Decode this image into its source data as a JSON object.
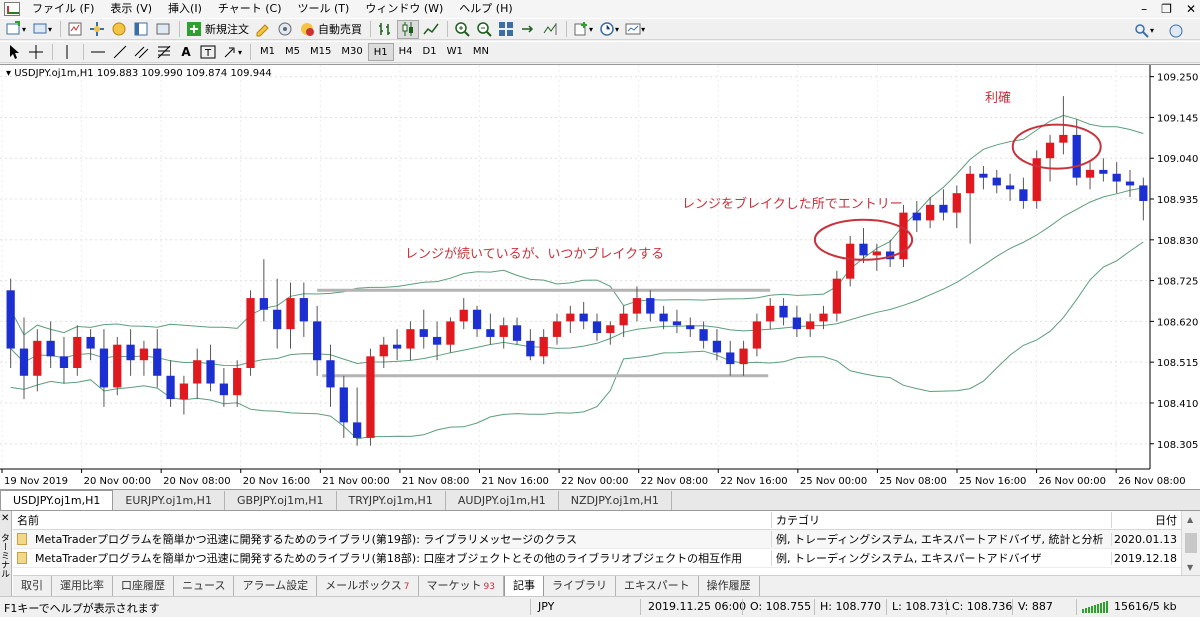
{
  "menu": [
    "ファイル (F)",
    "表示 (V)",
    "挿入(I)",
    "チャート (C)",
    "ツール (T)",
    "ウィンドウ (W)",
    "ヘルプ (H)"
  ],
  "toolbar": {
    "new_order_label": "新規注文",
    "auto_trade_label": "自動売買"
  },
  "timeframes": [
    "M1",
    "M5",
    "M15",
    "M30",
    "H1",
    "H4",
    "D1",
    "W1",
    "MN"
  ],
  "active_timeframe": "H1",
  "chart": {
    "header": "USDJPY.oj1m,H1  109.883 109.990 109.874 109.944",
    "colors": {
      "bull": "#e0191f",
      "bear": "#1c2fd0",
      "band": "#5c9e7c",
      "annotation": "#c8323c",
      "range_line": "#b4b4b4"
    },
    "annotations": {
      "range": "レンジが続いているが、いつかブレイクする",
      "breakout": "レンジをブレイクした所でエントリー",
      "take_profit": "利確"
    }
  },
  "chart_data": {
    "type": "candlestick",
    "symbol": "USDJPY.oj1m",
    "timeframe": "H1",
    "ylim": [
      108.24,
      109.28
    ],
    "y_ticks": [
      "109.250",
      "109.145",
      "109.040",
      "108.935",
      "108.830",
      "108.725",
      "108.620",
      "108.515",
      "108.410",
      "108.305"
    ],
    "x_ticks": [
      "19 Nov 2019",
      "20 Nov 00:00",
      "20 Nov 08:00",
      "20 Nov 16:00",
      "21 Nov 00:00",
      "21 Nov 08:00",
      "21 Nov 16:00",
      "22 Nov 00:00",
      "22 Nov 08:00",
      "22 Nov 16:00",
      "25 Nov 00:00",
      "25 Nov 08:00",
      "25 Nov 16:00",
      "26 Nov 00:00",
      "26 Nov 08:00"
    ],
    "resistance": 108.7,
    "support": 108.48,
    "candles": [
      [
        108.7,
        108.73,
        108.5,
        108.55
      ],
      [
        108.55,
        108.63,
        108.42,
        108.48
      ],
      [
        108.48,
        108.6,
        108.44,
        108.57
      ],
      [
        108.57,
        108.62,
        108.5,
        108.53
      ],
      [
        108.53,
        108.58,
        108.46,
        108.5
      ],
      [
        108.5,
        108.61,
        108.48,
        108.58
      ],
      [
        108.58,
        108.6,
        108.52,
        108.55
      ],
      [
        108.55,
        108.6,
        108.4,
        108.45
      ],
      [
        108.45,
        108.58,
        108.43,
        108.56
      ],
      [
        108.56,
        108.6,
        108.48,
        108.52
      ],
      [
        108.52,
        108.57,
        108.48,
        108.55
      ],
      [
        108.55,
        108.6,
        108.45,
        108.48
      ],
      [
        108.48,
        108.52,
        108.4,
        108.42
      ],
      [
        108.42,
        108.48,
        108.38,
        108.46
      ],
      [
        108.46,
        108.55,
        108.42,
        108.52
      ],
      [
        108.52,
        108.56,
        108.44,
        108.46
      ],
      [
        108.46,
        108.5,
        108.4,
        108.43
      ],
      [
        108.43,
        108.52,
        108.4,
        108.5
      ],
      [
        108.5,
        108.7,
        108.48,
        108.68
      ],
      [
        108.68,
        108.78,
        108.62,
        108.65
      ],
      [
        108.65,
        108.73,
        108.55,
        108.6
      ],
      [
        108.6,
        108.72,
        108.55,
        108.68
      ],
      [
        108.68,
        108.72,
        108.58,
        108.62
      ],
      [
        108.62,
        108.66,
        108.48,
        108.52
      ],
      [
        108.52,
        108.56,
        108.4,
        108.45
      ],
      [
        108.45,
        108.48,
        108.32,
        108.36
      ],
      [
        108.36,
        108.45,
        108.3,
        108.32
      ],
      [
        108.32,
        108.55,
        108.3,
        108.53
      ],
      [
        108.53,
        108.58,
        108.5,
        108.56
      ],
      [
        108.56,
        108.6,
        108.52,
        108.55
      ],
      [
        108.55,
        108.62,
        108.52,
        108.6
      ],
      [
        108.6,
        108.65,
        108.55,
        108.58
      ],
      [
        108.58,
        108.62,
        108.52,
        108.56
      ],
      [
        108.56,
        108.63,
        108.54,
        108.62
      ],
      [
        108.62,
        108.68,
        108.6,
        108.65
      ],
      [
        108.65,
        108.66,
        108.58,
        108.6
      ],
      [
        108.6,
        108.64,
        108.56,
        108.58
      ],
      [
        108.58,
        108.63,
        108.55,
        108.61
      ],
      [
        108.61,
        108.63,
        108.56,
        108.57
      ],
      [
        108.57,
        108.6,
        108.52,
        108.53
      ],
      [
        108.53,
        108.6,
        108.51,
        108.58
      ],
      [
        108.58,
        108.64,
        108.56,
        108.62
      ],
      [
        108.62,
        108.66,
        108.59,
        108.64
      ],
      [
        108.64,
        108.67,
        108.6,
        108.62
      ],
      [
        108.62,
        108.64,
        108.57,
        108.59
      ],
      [
        108.59,
        108.62,
        108.56,
        108.61
      ],
      [
        108.61,
        108.66,
        108.58,
        108.64
      ],
      [
        108.64,
        108.71,
        108.62,
        108.68
      ],
      [
        108.68,
        108.7,
        108.62,
        108.64
      ],
      [
        108.64,
        108.66,
        108.6,
        108.62
      ],
      [
        108.62,
        108.65,
        108.59,
        108.61
      ],
      [
        108.61,
        108.63,
        108.58,
        108.6
      ],
      [
        108.6,
        108.62,
        108.55,
        108.57
      ],
      [
        108.57,
        108.6,
        108.52,
        108.54
      ],
      [
        108.54,
        108.57,
        108.48,
        108.51
      ],
      [
        108.51,
        108.57,
        108.48,
        108.55
      ],
      [
        108.55,
        108.64,
        108.53,
        108.62
      ],
      [
        108.62,
        108.68,
        108.6,
        108.66
      ],
      [
        108.66,
        108.68,
        108.61,
        108.63
      ],
      [
        108.63,
        108.66,
        108.58,
        108.6
      ],
      [
        108.6,
        108.64,
        108.58,
        108.62
      ],
      [
        108.62,
        108.66,
        108.6,
        108.64
      ],
      [
        108.64,
        108.75,
        108.62,
        108.73
      ],
      [
        108.73,
        108.84,
        108.71,
        108.82
      ],
      [
        108.82,
        108.86,
        108.77,
        108.79
      ],
      [
        108.79,
        108.82,
        108.75,
        108.8
      ],
      [
        108.8,
        108.83,
        108.76,
        108.78
      ],
      [
        108.78,
        108.92,
        108.76,
        108.9
      ],
      [
        108.9,
        108.93,
        108.85,
        108.88
      ],
      [
        108.88,
        108.94,
        108.86,
        108.92
      ],
      [
        108.92,
        108.96,
        108.88,
        108.9
      ],
      [
        108.9,
        108.97,
        108.86,
        108.95
      ],
      [
        108.95,
        109.02,
        108.82,
        109.0
      ],
      [
        109.0,
        109.02,
        108.96,
        108.99
      ],
      [
        108.99,
        109.01,
        108.95,
        108.97
      ],
      [
        108.97,
        109.0,
        108.93,
        108.96
      ],
      [
        108.96,
        108.99,
        108.91,
        108.93
      ],
      [
        108.93,
        109.06,
        108.91,
        109.04
      ],
      [
        109.04,
        109.1,
        108.98,
        109.08
      ],
      [
        109.08,
        109.2,
        109.05,
        109.1
      ],
      [
        109.1,
        109.14,
        108.97,
        108.99
      ],
      [
        108.99,
        109.03,
        108.96,
        109.01
      ],
      [
        109.01,
        109.04,
        108.98,
        109.0
      ],
      [
        109.0,
        109.03,
        108.95,
        108.98
      ],
      [
        108.98,
        109.01,
        108.94,
        108.97
      ],
      [
        108.97,
        108.99,
        108.88,
        108.93
      ]
    ]
  },
  "symbol_tabs": [
    "USDJPY.oj1m,H1",
    "EURJPY.oj1m,H1",
    "GBPJPY.oj1m,H1",
    "TRYJPY.oj1m,H1",
    "AUDJPY.oj1m,H1",
    "NZDJPY.oj1m,H1"
  ],
  "terminal": {
    "side_label": "ターミナル",
    "columns": {
      "name": "名前",
      "category": "カテゴリ",
      "date": "日付"
    },
    "rows": [
      {
        "name": "MetaTraderプログラムを簡単かつ迅速に開発するためのライブラリ(第19部): ライブラリメッセージのクラス",
        "category": "例, トレーディングシステム, エキスパートアドバイザ, 統計と分析",
        "date": "2020.01.13"
      },
      {
        "name": "MetaTraderプログラムを簡単かつ迅速に開発するためのライブラリ(第18部): 口座オブジェクトとその他のライブラリオブジェクトの相互作用",
        "category": "例, トレーディングシステム, エキスパートアドバイザ",
        "date": "2019.12.18"
      }
    ],
    "tabs": [
      {
        "label": "取引",
        "badge": ""
      },
      {
        "label": "運用比率",
        "badge": ""
      },
      {
        "label": "口座履歴",
        "badge": ""
      },
      {
        "label": "ニュース",
        "badge": ""
      },
      {
        "label": "アラーム設定",
        "badge": ""
      },
      {
        "label": "メールボックス",
        "badge": "7"
      },
      {
        "label": "マーケット",
        "badge": "93"
      },
      {
        "label": "記事",
        "badge": ""
      },
      {
        "label": "ライブラリ",
        "badge": ""
      },
      {
        "label": "エキスパート",
        "badge": ""
      },
      {
        "label": "操作履歴",
        "badge": ""
      }
    ],
    "active_tab": "記事"
  },
  "status": {
    "help": "F1キーでヘルプが表示されます",
    "profile": "JPY",
    "time": "2019.11.25 06:00",
    "open": "O: 108.755",
    "high": "H: 108.770",
    "low": "L: 108.731",
    "close": "C: 108.736",
    "volume": "V: 887",
    "traffic": "15616/5 kb"
  }
}
